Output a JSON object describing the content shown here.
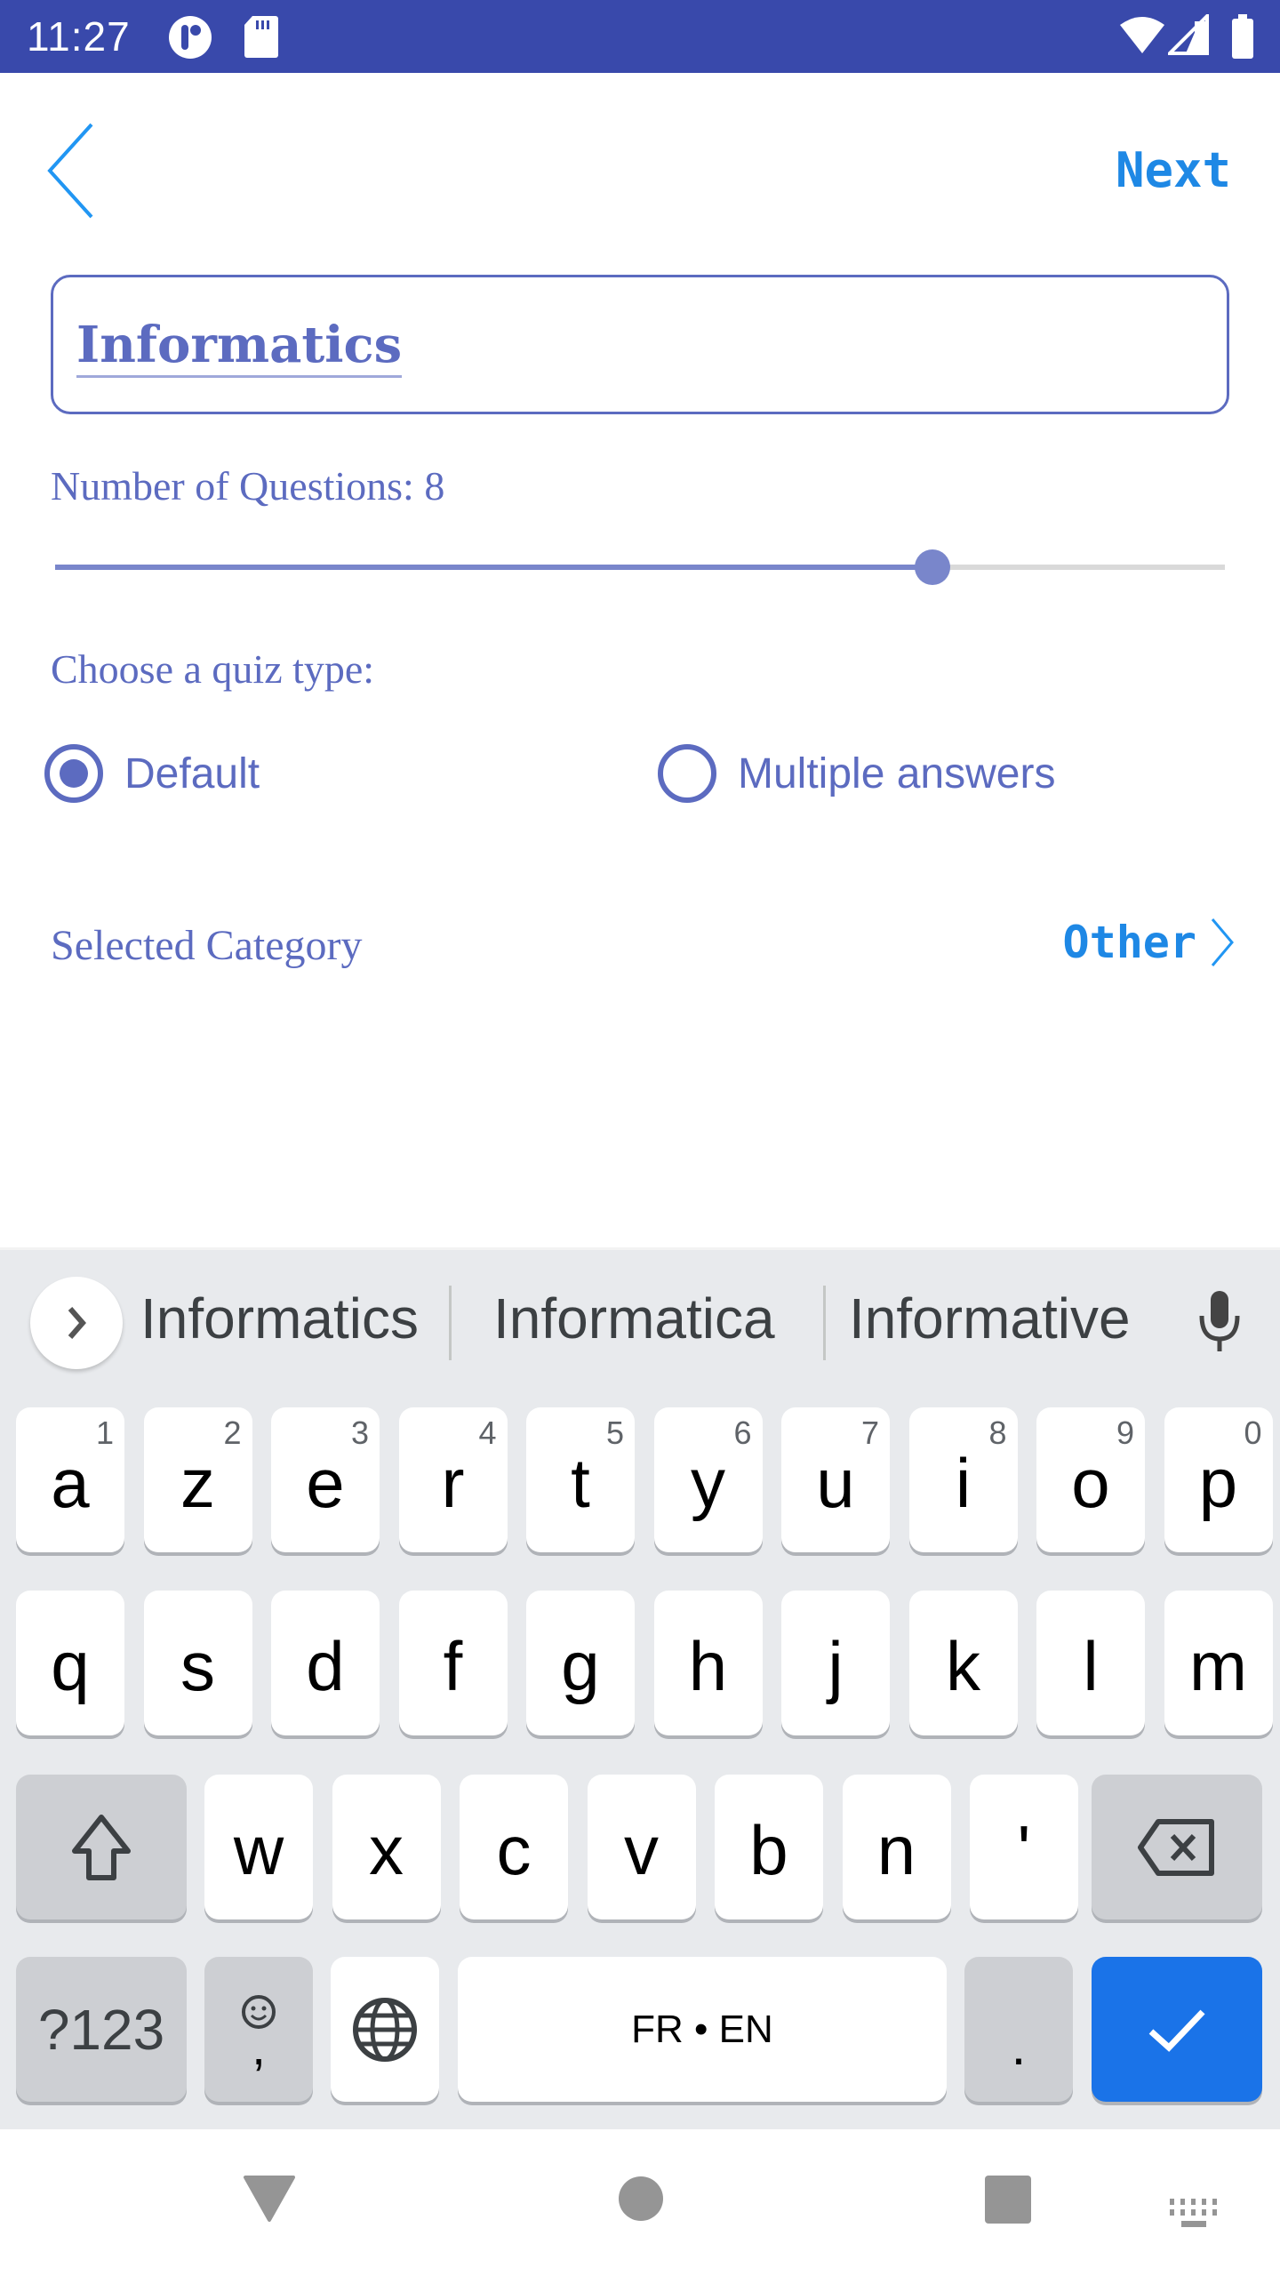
{
  "status_bar": {
    "time": "11:27",
    "left_icons": [
      "notification-app-icon",
      "sd-card-icon"
    ],
    "right_icons": [
      "wifi-icon",
      "signal-icon",
      "battery-icon"
    ],
    "background": "#3949AB"
  },
  "header": {
    "back_icon": "chevron-left-icon",
    "next_label": "Next"
  },
  "quiz_name": {
    "value": "Informatics"
  },
  "questions": {
    "label": "Number of Questions: 8",
    "value": 8,
    "slider_fraction": 0.75
  },
  "quiz_type": {
    "label": "Choose a quiz type:",
    "options": [
      {
        "label": "Default",
        "checked": true
      },
      {
        "label": "Multiple answers",
        "checked": false
      }
    ]
  },
  "category": {
    "label": "Selected Category",
    "value": "Other"
  },
  "keyboard": {
    "suggestions": [
      "Informatics",
      "Informatica",
      "Informative"
    ],
    "row1": [
      {
        "key": "a",
        "hint": "1"
      },
      {
        "key": "z",
        "hint": "2"
      },
      {
        "key": "e",
        "hint": "3"
      },
      {
        "key": "r",
        "hint": "4"
      },
      {
        "key": "t",
        "hint": "5"
      },
      {
        "key": "y",
        "hint": "6"
      },
      {
        "key": "u",
        "hint": "7"
      },
      {
        "key": "i",
        "hint": "8"
      },
      {
        "key": "o",
        "hint": "9"
      },
      {
        "key": "p",
        "hint": "0"
      }
    ],
    "row2": [
      "q",
      "s",
      "d",
      "f",
      "g",
      "h",
      "j",
      "k",
      "l",
      "m"
    ],
    "row3": [
      "w",
      "x",
      "c",
      "v",
      "b",
      "n",
      "'"
    ],
    "symbols_label": "?123",
    "comma_label": ",",
    "space_label": "FR • EN",
    "period_label": ".",
    "accent": "#1A73E8"
  },
  "nav_bar": {
    "buttons": [
      "back-triangle-icon",
      "home-circle-icon",
      "recents-square-icon",
      "keyboard-switch-icon"
    ]
  },
  "colors": {
    "primary": "#5C6BC0",
    "link": "#1E88E5",
    "slider": "#7986CB"
  }
}
